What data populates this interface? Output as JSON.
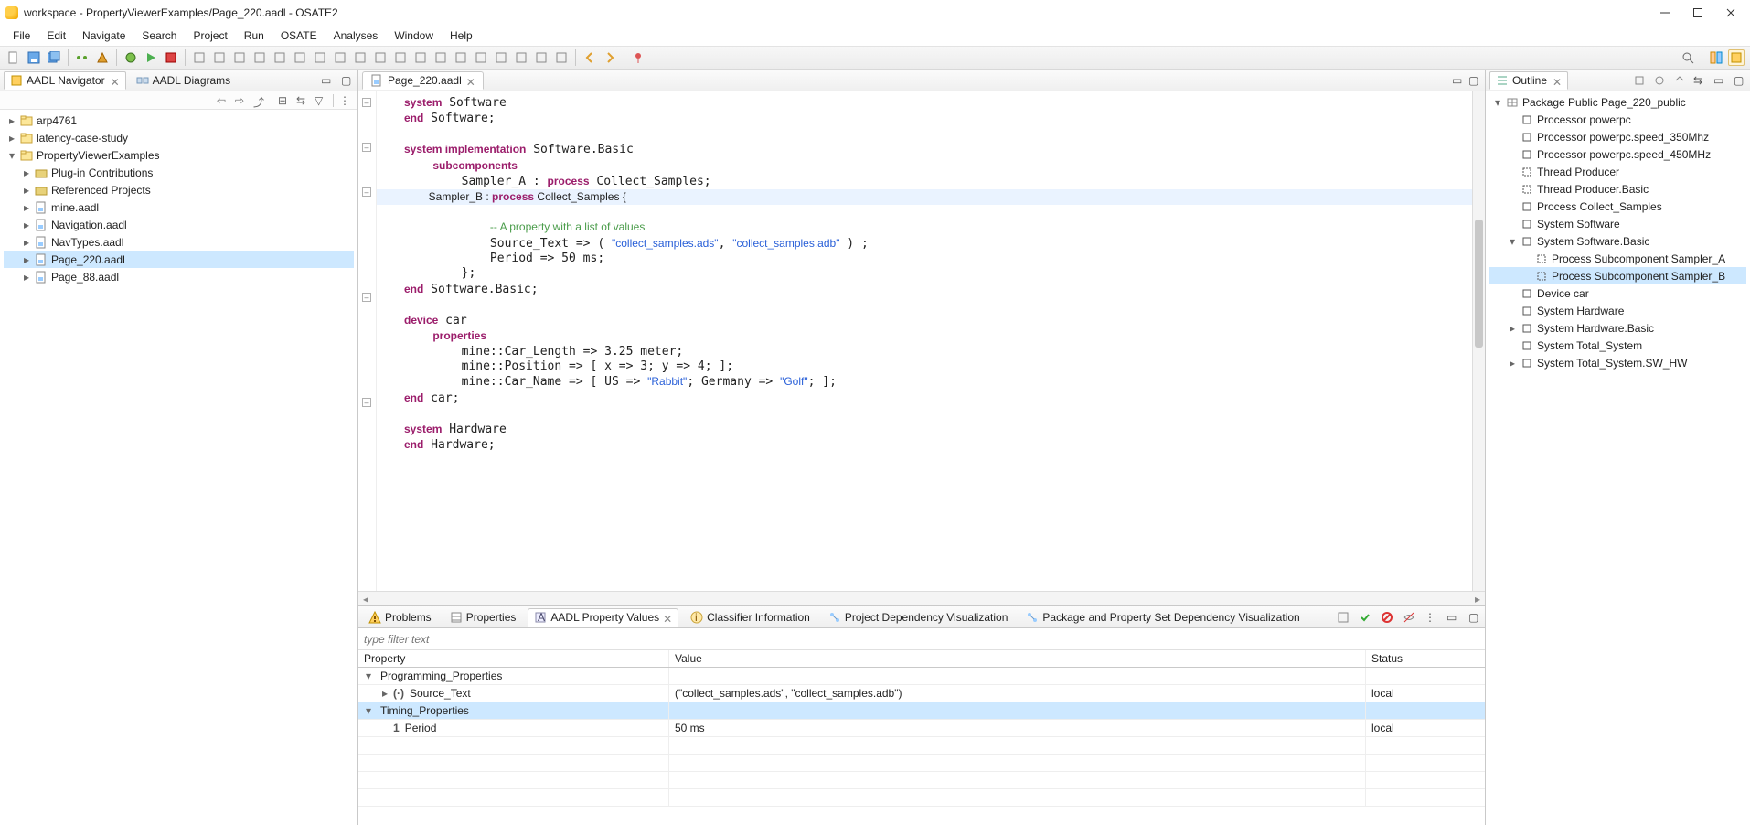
{
  "window": {
    "title": "workspace - PropertyViewerExamples/Page_220.aadl - OSATE2"
  },
  "menu": [
    "File",
    "Edit",
    "Navigate",
    "Search",
    "Project",
    "Run",
    "OSATE",
    "Analyses",
    "Window",
    "Help"
  ],
  "left_views": {
    "navigator_tab": "AADL Navigator",
    "diagrams_tab": "AADL Diagrams",
    "tree": [
      {
        "label": "arp4761",
        "icon": "project",
        "expand": "closed",
        "depth": 0
      },
      {
        "label": "latency-case-study",
        "icon": "project",
        "expand": "closed",
        "depth": 0
      },
      {
        "label": "PropertyViewerExamples",
        "icon": "project",
        "expand": "open",
        "depth": 0
      },
      {
        "label": "Plug-in Contributions",
        "icon": "folder",
        "expand": "closed",
        "depth": 1
      },
      {
        "label": "Referenced Projects",
        "icon": "folder",
        "expand": "closed",
        "depth": 1
      },
      {
        "label": "mine.aadl",
        "icon": "aadl",
        "expand": "closed",
        "depth": 1
      },
      {
        "label": "Navigation.aadl",
        "icon": "aadl",
        "expand": "closed",
        "depth": 1
      },
      {
        "label": "NavTypes.aadl",
        "icon": "aadl",
        "expand": "closed",
        "depth": 1
      },
      {
        "label": "Page_220.aadl",
        "icon": "aadl",
        "expand": "closed",
        "depth": 1,
        "selected": true
      },
      {
        "label": "Page_88.aadl",
        "icon": "aadl",
        "expand": "closed",
        "depth": 1
      }
    ]
  },
  "editor": {
    "tab_label": "Page_220.aadl",
    "lines": [
      {
        "t": "<kw>system</kw> Software"
      },
      {
        "t": "<kw>end</kw> Software;"
      },
      {
        "t": ""
      },
      {
        "t": "<kw>system implementation</kw> Software.Basic"
      },
      {
        "t": "    <kw>subcomponents</kw>"
      },
      {
        "t": "        Sampler_A : <kw>process</kw> Collect_Samples;"
      },
      {
        "t": "        Sampler_B : <kw>process</kw> Collect_Samples {",
        "hl": true
      },
      {
        "t": "            <cm>-- A property with a list of values</cm>"
      },
      {
        "t": "            Source_Text =&gt; ( <str>\"collect_samples.ads\"</str>, <str>\"collect_samples.adb\"</str> ) ;"
      },
      {
        "t": "            Period =&gt; 50 ms;"
      },
      {
        "t": "        };"
      },
      {
        "t": "<kw>end</kw> Software.Basic;"
      },
      {
        "t": ""
      },
      {
        "t": "<kw>device</kw> car"
      },
      {
        "t": "    <kw>properties</kw>"
      },
      {
        "t": "        mine::Car_Length =&gt; 3.25 meter;"
      },
      {
        "t": "        mine::Position =&gt; [ x =&gt; 3; y =&gt; 4; ];"
      },
      {
        "t": "        mine::Car_Name =&gt; [ US =&gt; <str>\"Rabbit\"</str>; Germany =&gt; <str>\"Golf\"</str>; ];"
      },
      {
        "t": "<kw>end</kw> car;"
      },
      {
        "t": ""
      },
      {
        "t": "<kw>system</kw> Hardware"
      },
      {
        "t": "<kw>end</kw> Hardware;"
      }
    ],
    "fold_rows": [
      0,
      3,
      6,
      13,
      20
    ]
  },
  "outline": {
    "title": "Outline",
    "tree": [
      {
        "label": "Package Public Page_220_public",
        "icon": "pkg",
        "expand": "open",
        "depth": 0
      },
      {
        "label": "Processor powerpc",
        "icon": "sq",
        "expand": "none",
        "depth": 1
      },
      {
        "label": "Processor powerpc.speed_350Mhz",
        "icon": "sq",
        "expand": "none",
        "depth": 1
      },
      {
        "label": "Processor powerpc.speed_450MHz",
        "icon": "sq",
        "expand": "none",
        "depth": 1
      },
      {
        "label": "Thread Producer",
        "icon": "dash",
        "expand": "none",
        "depth": 1
      },
      {
        "label": "Thread Producer.Basic",
        "icon": "dash",
        "expand": "none",
        "depth": 1
      },
      {
        "label": "Process Collect_Samples",
        "icon": "sq",
        "expand": "none",
        "depth": 1
      },
      {
        "label": "System Software",
        "icon": "sq",
        "expand": "none",
        "depth": 1
      },
      {
        "label": "System Software.Basic",
        "icon": "sq",
        "expand": "open",
        "depth": 1
      },
      {
        "label": "Process Subcomponent Sampler_A",
        "icon": "dash",
        "expand": "none",
        "depth": 2
      },
      {
        "label": "Process Subcomponent Sampler_B",
        "icon": "dash",
        "expand": "none",
        "depth": 2,
        "selected": true
      },
      {
        "label": "Device car",
        "icon": "sq",
        "expand": "none",
        "depth": 1
      },
      {
        "label": "System Hardware",
        "icon": "sq",
        "expand": "none",
        "depth": 1
      },
      {
        "label": "System Hardware.Basic",
        "icon": "sq",
        "expand": "closed",
        "depth": 1
      },
      {
        "label": "System Total_System",
        "icon": "sq",
        "expand": "none",
        "depth": 1
      },
      {
        "label": "System Total_System.SW_HW",
        "icon": "sq",
        "expand": "closed",
        "depth": 1
      }
    ]
  },
  "bottom": {
    "tabs": [
      {
        "label": "Problems",
        "icon": "warn"
      },
      {
        "label": "Properties",
        "icon": "props"
      },
      {
        "label": "AADL Property Values",
        "icon": "vals",
        "active": true,
        "closable": true
      },
      {
        "label": "Classifier Information",
        "icon": "info"
      },
      {
        "label": "Project Dependency Visualization",
        "icon": "graph"
      },
      {
        "label": "Package and Property Set Dependency Visualization",
        "icon": "graph"
      }
    ],
    "filter_placeholder": "type filter text",
    "columns": {
      "prop": "Property",
      "val": "Value",
      "stat": "Status"
    },
    "rows": [
      {
        "kind": "group",
        "expand": "open",
        "label": "Programming_Properties",
        "depth": 0
      },
      {
        "kind": "prop",
        "expand": "closed",
        "badge": "(·)",
        "label": "Source_Text",
        "value": "(\"collect_samples.ads\", \"collect_samples.adb\")",
        "status": "local",
        "depth": 1
      },
      {
        "kind": "group",
        "expand": "open",
        "label": "Timing_Properties",
        "depth": 0,
        "selected": true
      },
      {
        "kind": "prop",
        "expand": "none",
        "badge": "1",
        "label": "Period",
        "value": "50 ms",
        "status": "local",
        "depth": 1
      }
    ]
  }
}
